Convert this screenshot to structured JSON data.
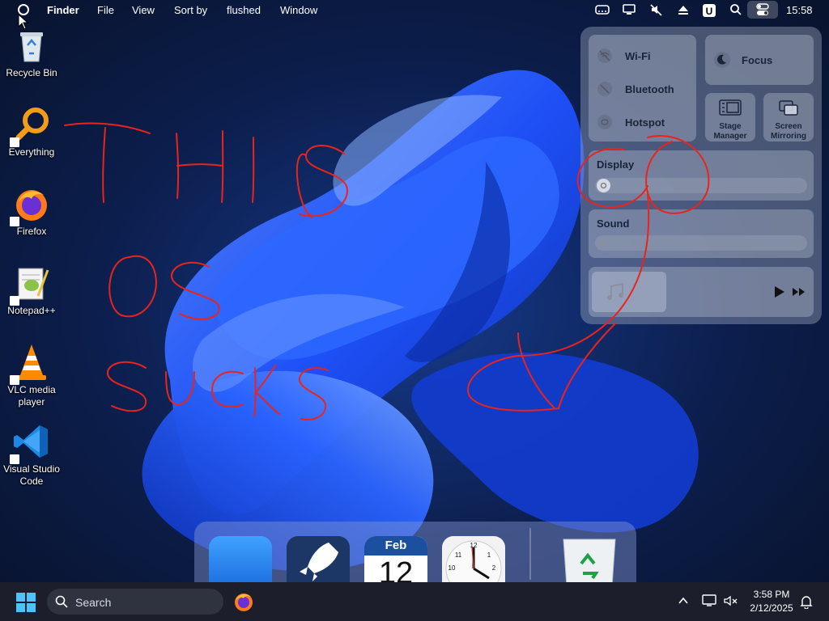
{
  "menubar": {
    "app_name": "Finder",
    "items": [
      "File",
      "View",
      "Sort by",
      "flushed",
      "Window"
    ],
    "status_icons": [
      "drive-icon",
      "monitor-icon",
      "mute-icon",
      "eject-icon",
      "u-icon",
      "search-icon",
      "control-center-icon"
    ],
    "clock": "15:58"
  },
  "desktop": {
    "icons": [
      {
        "label": "Recycle Bin",
        "icon": "recycle-bin-icon"
      },
      {
        "label": "Everything",
        "icon": "everything-icon"
      },
      {
        "label": "Firefox",
        "icon": "firefox-icon"
      },
      {
        "label": "Notepad++",
        "icon": "notepadpp-icon"
      },
      {
        "label": "VLC media player",
        "icon": "vlc-icon"
      },
      {
        "label": "Visual Studio Code",
        "icon": "vscode-icon"
      }
    ]
  },
  "control_center": {
    "wifi": "Wi-Fi",
    "bluetooth": "Bluetooth",
    "hotspot": "Hotspot",
    "focus": "Focus",
    "stage_manager": "Stage Manager",
    "screen_mirroring": "Screen Mirroring",
    "display": "Display",
    "sound": "Sound",
    "display_level": 0,
    "sound_level": 0
  },
  "dock": {
    "items": [
      "finder-icon",
      "launchpad-icon",
      "calendar-icon",
      "clock-icon",
      "trash-icon"
    ],
    "calendar_month": "Feb",
    "calendar_day": "12"
  },
  "taskbar": {
    "search_placeholder": "Search",
    "time": "3:58 PM",
    "date": "2/12/2025"
  },
  "annotation": {
    "text": "THIS OS SUCKS",
    "color": "#e8241c"
  },
  "colors": {
    "wallpaper_accent": "#1f52ff",
    "taskbar": "#1c1f2b"
  }
}
